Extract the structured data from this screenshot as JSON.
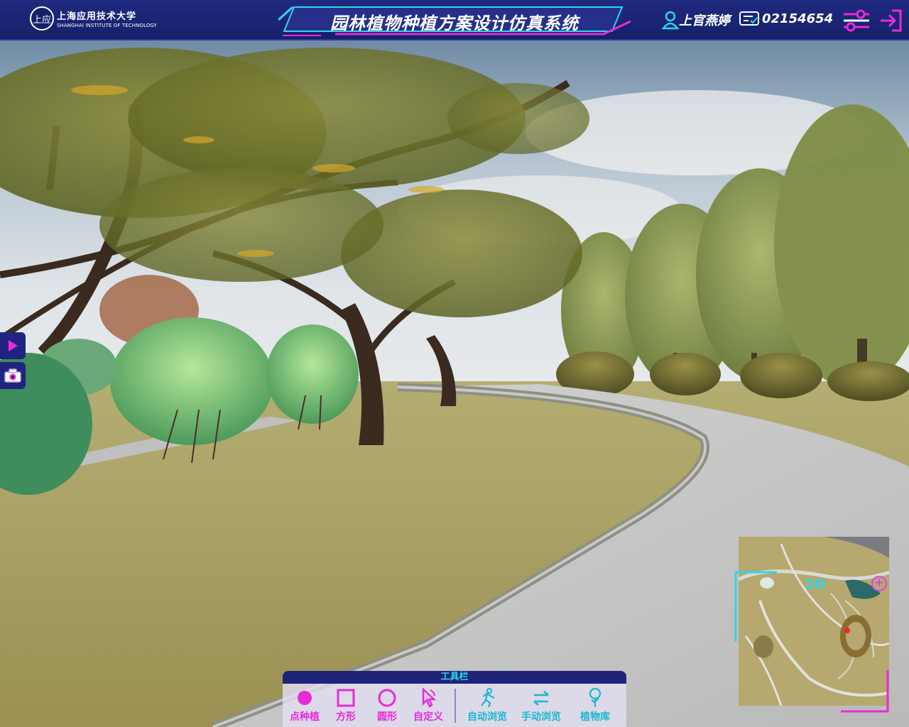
{
  "header": {
    "logo_seal": "上应",
    "logo_cn": "上海应用技术大学",
    "logo_en": "SHANGHAI INSTITUTE OF TECHNOLOGY",
    "title": "园林植物种植方案设计仿真系统",
    "user_name": "上官燕婷",
    "user_id": "02154654",
    "icons": {
      "user": "user-icon",
      "id": "id-card-icon",
      "settings": "settings-sliders-icon",
      "exit": "logout-icon"
    }
  },
  "side_controls": {
    "play_icon": "play-icon",
    "camera_icon": "camera-icon"
  },
  "minimap": {
    "view_mode": "2D",
    "zoom_symbol": "+"
  },
  "toolbar": {
    "title": "工具栏",
    "tools": [
      {
        "label": "点种植",
        "icon": "dot-plant-icon"
      },
      {
        "label": "方形",
        "icon": "square-icon"
      },
      {
        "label": "圆形",
        "icon": "circle-icon"
      },
      {
        "label": "自定义",
        "icon": "custom-pointer-icon"
      },
      {
        "label": "自动浏览",
        "icon": "auto-walk-icon"
      },
      {
        "label": "手动浏览",
        "icon": "manual-arrows-icon"
      },
      {
        "label": "植物库",
        "icon": "plant-library-icon"
      }
    ]
  },
  "colors": {
    "header_bg": "#1a2474",
    "accent_magenta": "#e92ad8",
    "accent_cyan": "#2fd6e8"
  }
}
